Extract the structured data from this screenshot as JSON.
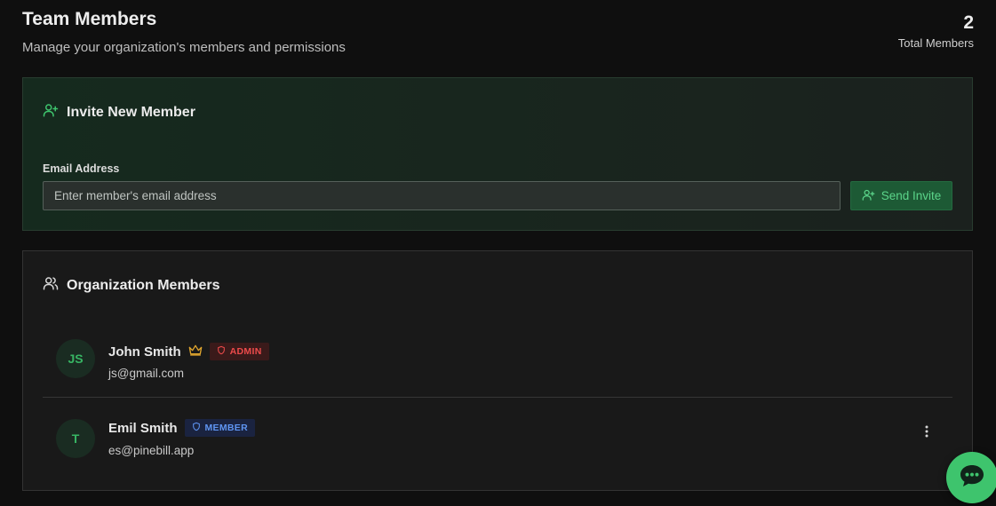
{
  "header": {
    "title": "Team Members",
    "subtitle": "Manage your organization's members and permissions",
    "total_count": "2",
    "total_label": "Total Members"
  },
  "invite": {
    "heading": "Invite New Member",
    "email_label": "Email Address",
    "email_value": "",
    "email_placeholder": "Enter member's email address",
    "send_label": "Send Invite",
    "accent_color": "#3ec46d"
  },
  "members": {
    "heading": "Organization Members",
    "list": [
      {
        "initials": "JS",
        "name": "John Smith",
        "owner_icon": "crown-icon",
        "role": "ADMIN",
        "role_icon": "shield-icon",
        "role_color": "#ee4b4b",
        "email": "js@gmail.com"
      },
      {
        "initials": "T",
        "name": "Emil Smith",
        "role": "MEMBER",
        "role_icon": "shield-icon",
        "role_color": "#5f95f2",
        "email": "es@pinebill.app",
        "actions_icon": "more-vertical-icon"
      }
    ]
  },
  "chat": {
    "icon": "chat-bubble-icon"
  }
}
